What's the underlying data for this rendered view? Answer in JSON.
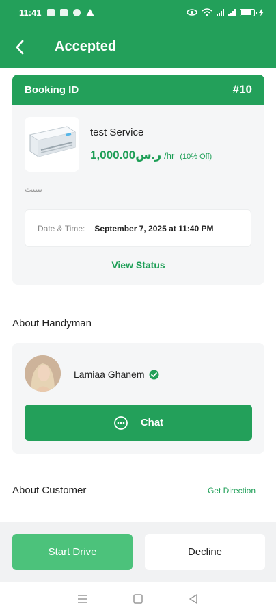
{
  "status_bar": {
    "time": "11:41",
    "colors": {
      "accent": "#23a05a",
      "accent_text": "#1d9e56",
      "button_light": "#4cc27b"
    }
  },
  "header": {
    "title": "Accepted",
    "back_icon": "back-arrow-icon"
  },
  "booking": {
    "label": "Booking ID",
    "id": "#10",
    "service_name": "test Service",
    "price": "1,000.00ر.س",
    "price_unit": "/hr",
    "discount": "(10% Off)",
    "description": "تنتنت",
    "datetime_label": "Date & Time:",
    "datetime_value": "September 7, 2025 at 11:40 PM",
    "view_status": "View Status"
  },
  "handyman": {
    "section_title": "About Handyman",
    "name": "Lamiaa Ghanem",
    "chat_label": "Chat"
  },
  "customer": {
    "section_title": "About Customer",
    "get_direction": "Get Direction"
  },
  "actions": {
    "start_drive": "Start Drive",
    "decline": "Decline"
  }
}
